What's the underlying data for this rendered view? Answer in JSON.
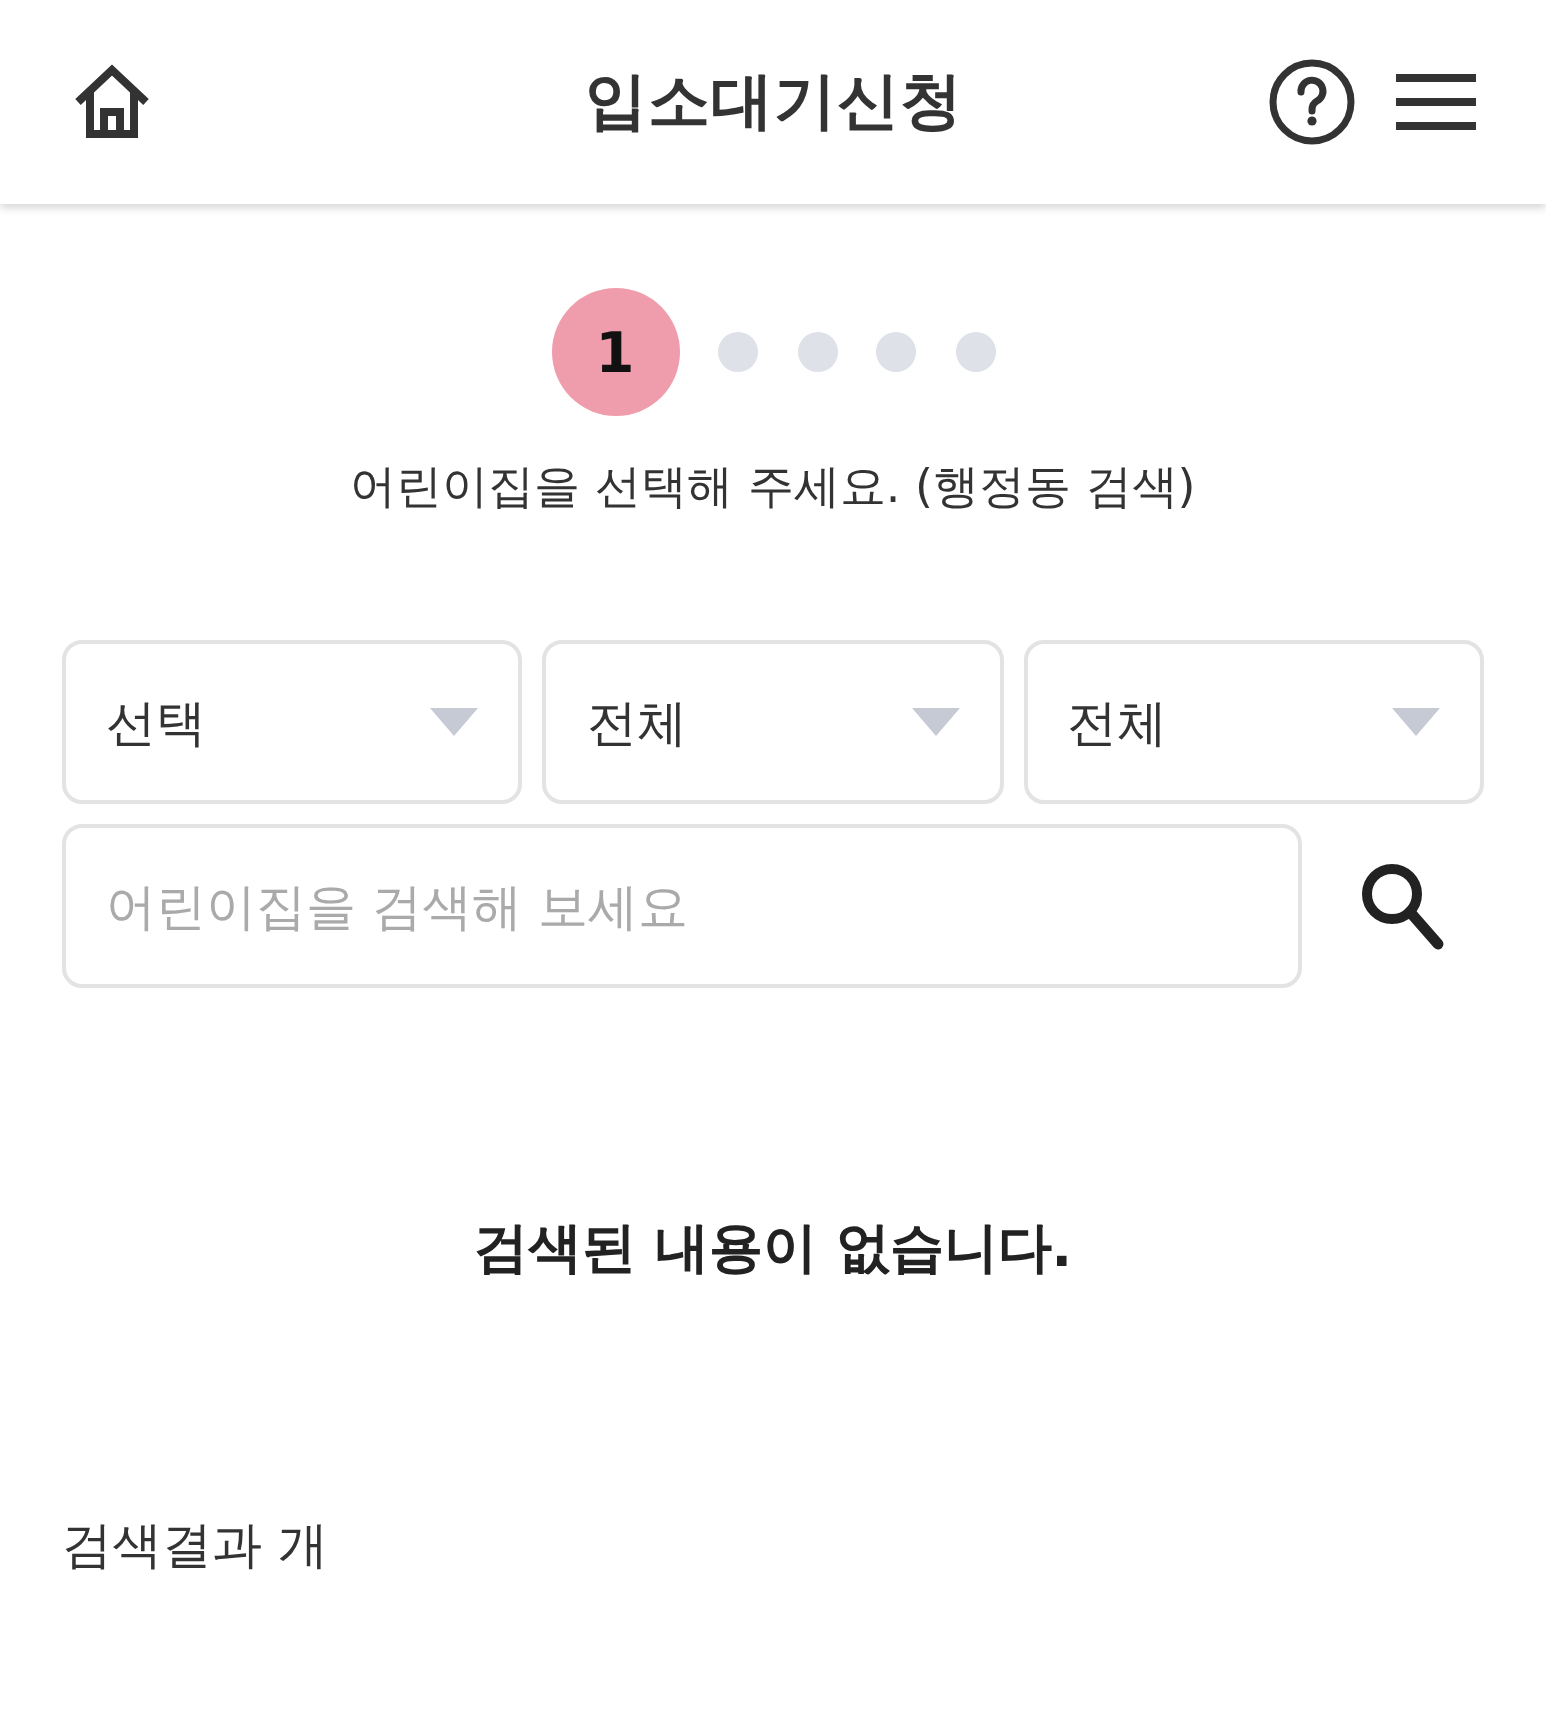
{
  "header": {
    "title": "입소대기신청"
  },
  "steps": [
    {
      "label": "1",
      "selected": true
    },
    {
      "selected": false
    },
    {
      "selected": false
    },
    {
      "selected": false
    },
    {
      "selected": false
    }
  ],
  "instruction": "어린이집을 선택해 주세요. (행정동 검색)",
  "filters": [
    {
      "value": "선택"
    },
    {
      "value": "전체"
    },
    {
      "value": "전체"
    }
  ],
  "search": {
    "placeholder": "어린이집을 검색해 보세요"
  },
  "empty_message": "검색된 내용이 없습니다.",
  "result_count": "검색결과 개"
}
